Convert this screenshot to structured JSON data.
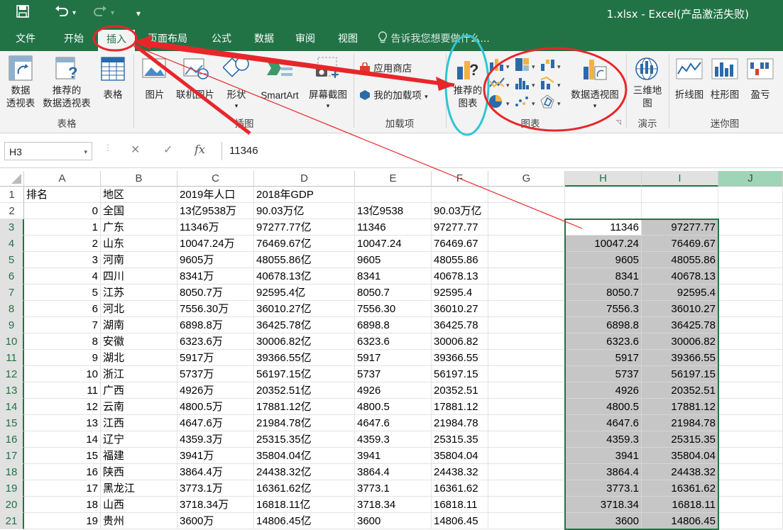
{
  "window": {
    "title": "1.xlsx - Excel(产品激活失败)",
    "accent": "#217346",
    "quick_access": {
      "save_icon": "save-icon",
      "undo_icon": "undo-icon",
      "redo_icon": "redo-icon",
      "customize_icon": "customize-icon"
    }
  },
  "tabs": [
    "文件",
    "开始",
    "插入",
    "页面布局",
    "公式",
    "数据",
    "审阅",
    "视图"
  ],
  "active_tab": "插入",
  "tell_me": "告诉我您想要做什么...",
  "ribbon": {
    "groups": [
      "表格",
      "插图",
      "加载项",
      "图表",
      "演示",
      "迷你图"
    ],
    "buttons": {
      "pivot_l1": "数据",
      "pivot_l2": "透视表",
      "rec_pivot_l1": "推荐的",
      "rec_pivot_l2": "数据透视表",
      "table": "表格",
      "picture": "图片",
      "online_picture": "联机图片",
      "shapes": "形状",
      "smartart": "SmartArt",
      "screenshot": "屏幕截图",
      "store": "应用商店",
      "my_addins": "我的加载项",
      "rec_charts_l1": "推荐的",
      "rec_charts_l2": "图表",
      "pivot_chart": "数据透视图",
      "map3d_l1": "三维地",
      "map3d_l2": "图",
      "spark_line": "折线图",
      "spark_column": "柱形图",
      "spark_winloss": "盈亏"
    }
  },
  "formula_bar": {
    "name_box": "H3",
    "fx": "fx",
    "cancel": "✕",
    "enter": "✓",
    "content": "11346"
  },
  "sheet": {
    "columns": [
      "A",
      "B",
      "C",
      "D",
      "E",
      "F",
      "G",
      "H",
      "I",
      "J"
    ],
    "selected_columns": [
      "H",
      "I"
    ],
    "rows": [
      [
        "排名",
        "地区",
        "2019年人口",
        "2018年GDP",
        "",
        "",
        "",
        "",
        ""
      ],
      [
        "0",
        "全国",
        "13亿9538万",
        "90.03万亿",
        "13亿9538",
        "90.03万亿",
        "",
        "",
        ""
      ],
      [
        "1",
        "广东",
        "11346万",
        "97277.77亿",
        "11346",
        "97277.77",
        "",
        "11346",
        "97277.77"
      ],
      [
        "2",
        "山东",
        "10047.24万",
        "76469.67亿",
        "10047.24",
        "76469.67",
        "",
        "10047.24",
        "76469.67"
      ],
      [
        "3",
        "河南",
        "9605万",
        "48055.86亿",
        "9605",
        "48055.86",
        "",
        "9605",
        "48055.86"
      ],
      [
        "4",
        "四川",
        "8341万",
        "40678.13亿",
        "8341",
        "40678.13",
        "",
        "8341",
        "40678.13"
      ],
      [
        "5",
        "江苏",
        "8050.7万",
        "92595.4亿",
        "8050.7",
        "92595.4",
        "",
        "8050.7",
        "92595.4"
      ],
      [
        "6",
        "河北",
        "7556.30万",
        "36010.27亿",
        "7556.30",
        "36010.27",
        "",
        "7556.3",
        "36010.27"
      ],
      [
        "7",
        "湖南",
        "6898.8万",
        "36425.78亿",
        "6898.8",
        "36425.78",
        "",
        "6898.8",
        "36425.78"
      ],
      [
        "8",
        "安徽",
        "6323.6万",
        "30006.82亿",
        "6323.6",
        "30006.82",
        "",
        "6323.6",
        "30006.82"
      ],
      [
        "9",
        "湖北",
        "5917万",
        "39366.55亿",
        "5917",
        "39366.55",
        "",
        "5917",
        "39366.55"
      ],
      [
        "10",
        "浙江",
        "5737万",
        "56197.15亿",
        "5737",
        "56197.15",
        "",
        "5737",
        "56197.15"
      ],
      [
        "11",
        "广西",
        "4926万",
        "20352.51亿",
        "4926",
        "20352.51",
        "",
        "4926",
        "20352.51"
      ],
      [
        "12",
        "云南",
        "4800.5万",
        "17881.12亿",
        "4800.5",
        "17881.12",
        "",
        "4800.5",
        "17881.12"
      ],
      [
        "13",
        "江西",
        "4647.6万",
        "21984.78亿",
        "4647.6",
        "21984.78",
        "",
        "4647.6",
        "21984.78"
      ],
      [
        "14",
        "辽宁",
        "4359.3万",
        "25315.35亿",
        "4359.3",
        "25315.35",
        "",
        "4359.3",
        "25315.35"
      ],
      [
        "15",
        "福建",
        "3941万",
        "35804.04亿",
        "3941",
        "35804.04",
        "",
        "3941",
        "35804.04"
      ],
      [
        "16",
        "陕西",
        "3864.4万",
        "24438.32亿",
        "3864.4",
        "24438.32",
        "",
        "3864.4",
        "24438.32"
      ],
      [
        "17",
        "黑龙江",
        "3773.1万",
        "16361.62亿",
        "3773.1",
        "16361.62",
        "",
        "3773.1",
        "16361.62"
      ],
      [
        "18",
        "山西",
        "3718.34万",
        "16818.11亿",
        "3718.34",
        "16818.11",
        "",
        "3718.34",
        "16818.11"
      ],
      [
        "19",
        "贵州",
        "3600万",
        "14806.45亿",
        "3600",
        "14806.45",
        "",
        "3600",
        "14806.45"
      ]
    ]
  }
}
